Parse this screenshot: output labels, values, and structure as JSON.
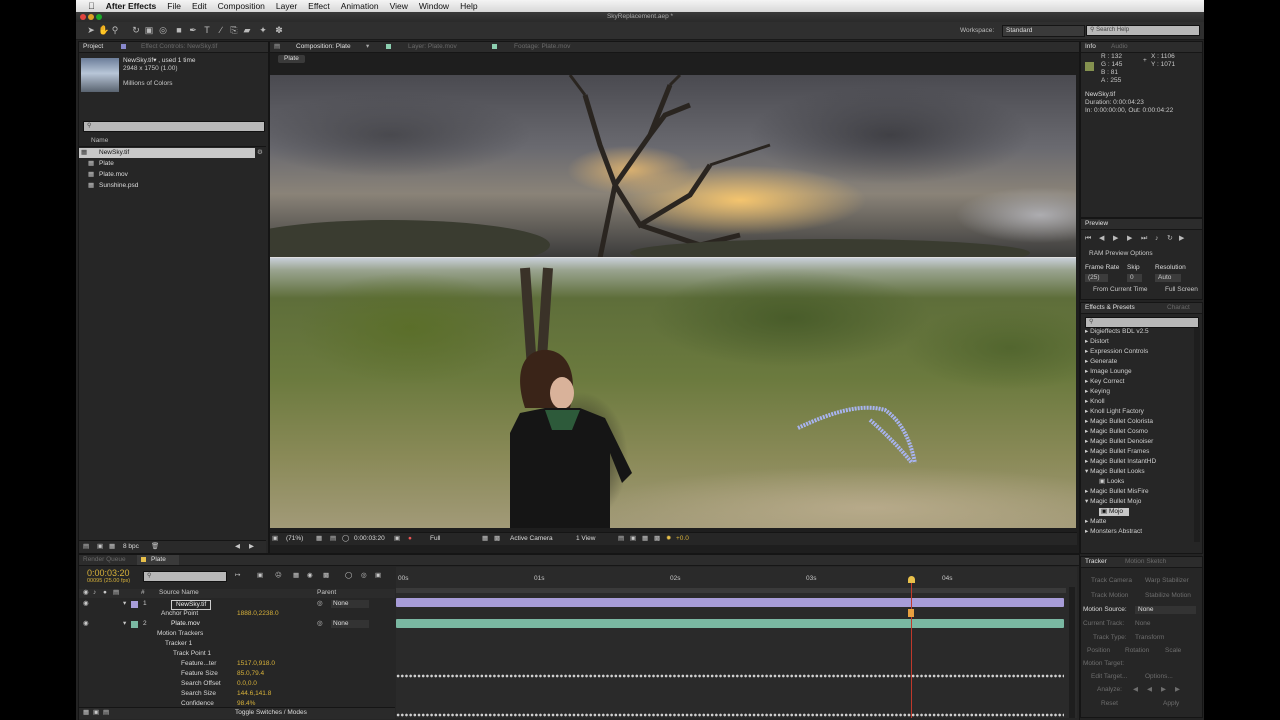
{
  "menubar": {
    "app": "After Effects",
    "items": [
      "File",
      "Edit",
      "Composition",
      "Layer",
      "Effect",
      "Animation",
      "View",
      "Window",
      "Help"
    ]
  },
  "titlebar": {
    "title": "SkyReplacement.aep *"
  },
  "toolbar": {
    "workspace_label": "Workspace:",
    "workspace_value": "Standard",
    "search_placeholder": "Search Help"
  },
  "project": {
    "tab_project": "Project",
    "tab_effect_controls": "Effect Controls: NewSky.tif",
    "selected_name": "NewSky.tif▾ , used 1 time",
    "selected_dims": "2948 x 1750 (1.00)",
    "selected_colors": "Millions of Colors",
    "column_name": "Name",
    "items": [
      "NewSky.tif",
      "Plate",
      "Plate.mov",
      "Sunshine.psd"
    ],
    "bpc": "8 bpc"
  },
  "composition": {
    "tab_comp": "Composition: Plate",
    "tab_layer": "Layer: Plate.mov",
    "tab_footage": "Footage: Plate.mov",
    "breadcrumb": "Plate",
    "zoom": "(71%)",
    "timecode": "0:00:03:20",
    "resolution": "Full",
    "camera": "Active Camera",
    "view": "1 View",
    "exposure": "+0.0"
  },
  "info": {
    "tab_info": "Info",
    "tab_audio": "Audio",
    "r": "R : 132",
    "g": "G : 145",
    "b": "B : 81",
    "a": "A : 255",
    "x": "X : 1106",
    "y": "Y : 1071",
    "file": "NewSky.tif",
    "duration": "Duration: 0:00:04:23",
    "inout": "In: 0:00:00:00, Out: 0:00:04:22",
    "swatch_color": "#84914f"
  },
  "preview": {
    "tab": "Preview",
    "ram_options": "RAM Preview Options",
    "frame_rate_label": "Frame Rate",
    "skip_label": "Skip",
    "resolution_label": "Resolution",
    "frame_rate": "(25)",
    "skip": "0",
    "resolution": "Auto",
    "from_current": "From Current Time",
    "full_screen": "Full Screen"
  },
  "effects": {
    "tab": "Effects & Presets",
    "tab2": "Charact",
    "items": [
      {
        "label": "Digieffects BDL v2.5",
        "indent": 0
      },
      {
        "label": "Distort",
        "indent": 0
      },
      {
        "label": "Expression Controls",
        "indent": 0
      },
      {
        "label": "Generate",
        "indent": 0
      },
      {
        "label": "Image Lounge",
        "indent": 0
      },
      {
        "label": "Key Correct",
        "indent": 0
      },
      {
        "label": "Keying",
        "indent": 0
      },
      {
        "label": "Knoll",
        "indent": 0
      },
      {
        "label": "Knoll Light Factory",
        "indent": 0
      },
      {
        "label": "Magic Bullet Colorista",
        "indent": 0
      },
      {
        "label": "Magic Bullet Cosmo",
        "indent": 0
      },
      {
        "label": "Magic Bullet Denoiser",
        "indent": 0
      },
      {
        "label": "Magic Bullet Frames",
        "indent": 0
      },
      {
        "label": "Magic Bullet InstantHD",
        "indent": 0
      },
      {
        "label": "Magic Bullet Looks",
        "indent": 0
      },
      {
        "label": "Looks",
        "indent": 1
      },
      {
        "label": "Magic Bullet MisFire",
        "indent": 0
      },
      {
        "label": "Magic Bullet Mojo",
        "indent": 0
      },
      {
        "label": "Mojo",
        "indent": 1
      },
      {
        "label": "Matte",
        "indent": 0
      },
      {
        "label": "Monsters Abstract",
        "indent": 0
      }
    ]
  },
  "timeline": {
    "tab_render": "Render Queue",
    "tab_plate": "Plate",
    "timecode": "0:00:03:20",
    "frame": "00095 (25.00 fps)",
    "col_source": "Source Name",
    "col_parent": "Parent",
    "ruler": [
      "00s",
      "01s",
      "02s",
      "03s",
      "04s"
    ],
    "rows": [
      {
        "num": "1",
        "name": "NewSky.tif",
        "parent": "None"
      },
      {
        "prop": "Anchor Point",
        "value": "1888.0,2238.0"
      },
      {
        "num": "2",
        "name": "Plate.mov",
        "parent": "None"
      },
      {
        "prop": "Motion Trackers"
      },
      {
        "prop": "Tracker 1"
      },
      {
        "prop": "Track Point 1"
      },
      {
        "prop": "Feature...ter",
        "value": "1517.0,918.0"
      },
      {
        "prop": "Feature Size",
        "value": "85.0,79.4"
      },
      {
        "prop": "Search Offset",
        "value": "0.0,0.0"
      },
      {
        "prop": "Search Size",
        "value": "144.6,141.8"
      },
      {
        "prop": "Confidence",
        "value": "98.4%"
      }
    ],
    "toggle": "Toggle Switches / Modes"
  },
  "tracker": {
    "tab": "Tracker",
    "tab2": "Motion Sketch",
    "track_camera": "Track Camera",
    "warp_stabilizer": "Warp Stabilizer",
    "track_motion": "Track Motion",
    "stabilize_motion": "Stabilize Motion",
    "motion_source_label": "Motion Source:",
    "motion_source": "None",
    "current_track_label": "Current Track:",
    "current_track": "None",
    "track_type_label": "Track Type:",
    "track_type": "Transform",
    "position": "Position",
    "rotation": "Rotation",
    "scale": "Scale",
    "motion_target": "Motion Target:",
    "edit_target": "Edit Target...",
    "options": "Options...",
    "analyze": "Analyze:",
    "reset": "Reset",
    "apply": "Apply"
  }
}
